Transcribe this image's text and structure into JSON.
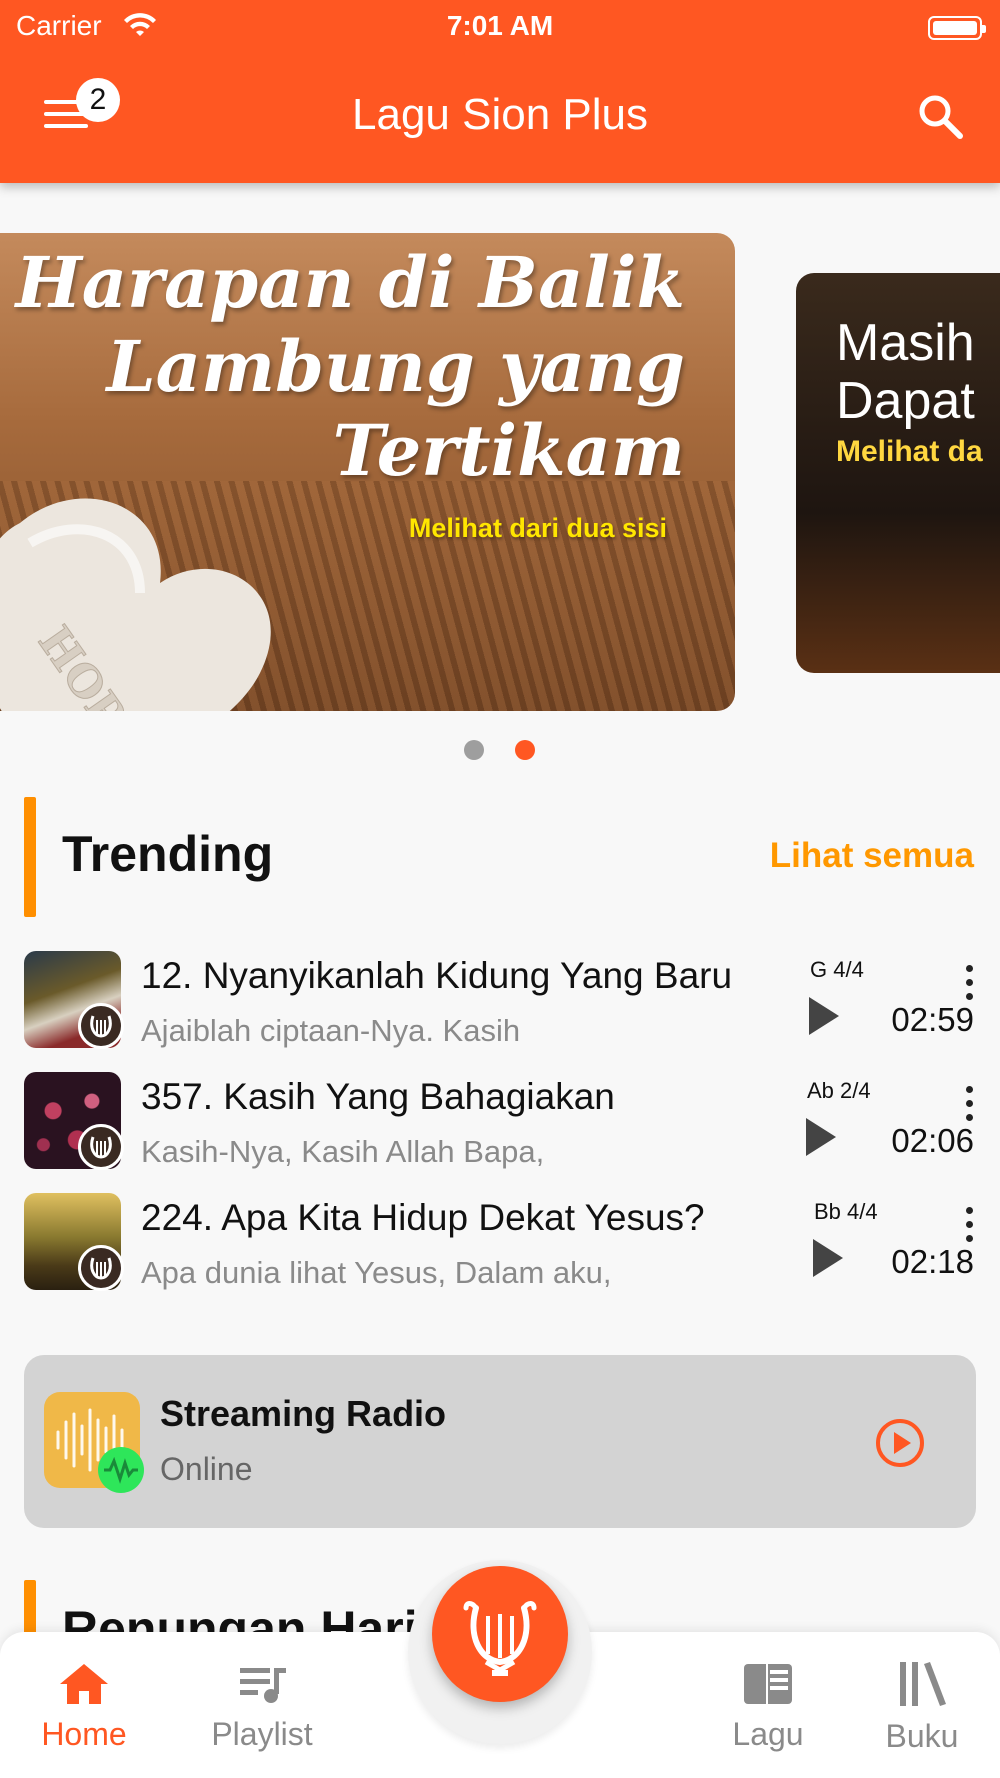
{
  "status_bar": {
    "carrier": "Carrier",
    "time": "7:01 AM"
  },
  "header": {
    "title": "Lagu Sion Plus",
    "menu_badge": "2"
  },
  "colors": {
    "primary": "#ff5722",
    "accent": "#ff9800",
    "online": "#2ee65a"
  },
  "carousel": {
    "slides": [
      {
        "lines": [
          "Harapan di Balik",
          "Lambung yang",
          "Tertikam"
        ],
        "subtitle": "Melihat dari dua sisi",
        "heart_text": "HOPE"
      },
      {
        "lines": [
          "Masih",
          "Dapat"
        ],
        "subtitle": "Melihat da"
      }
    ],
    "active_index": 1
  },
  "trending": {
    "title": "Trending",
    "see_all": "Lihat semua",
    "songs": [
      {
        "title": "12. Nyanyikanlah Kidung Yang Baru",
        "subtitle": " Ajaiblah ciptaan-Nya. Kasih",
        "key": "G 4/4",
        "duration": "02:59"
      },
      {
        "title": "357. Kasih Yang Bahagiakan",
        "subtitle": "Kasih-Nya, Kasih Allah Bapa,",
        "key": "Ab 2/4",
        "duration": "02:06"
      },
      {
        "title": "224. Apa Kita Hidup Dekat Yesus?",
        "subtitle": "Apa dunia lihat Yesus, Dalam aku,",
        "key": "Bb 4/4",
        "duration": "02:18"
      }
    ]
  },
  "radio": {
    "title": "Streaming Radio",
    "status": "Online"
  },
  "section2": {
    "title": "Renungan Harian"
  },
  "bottom_nav": {
    "items": [
      {
        "label": "Home",
        "icon": "home-icon",
        "active": true
      },
      {
        "label": "Playlist",
        "icon": "playlist-icon",
        "active": false
      },
      {
        "label": "Lagu",
        "icon": "book-open-icon",
        "active": false
      },
      {
        "label": "Buku",
        "icon": "library-icon",
        "active": false
      }
    ],
    "fab_icon": "lyre-icon"
  }
}
